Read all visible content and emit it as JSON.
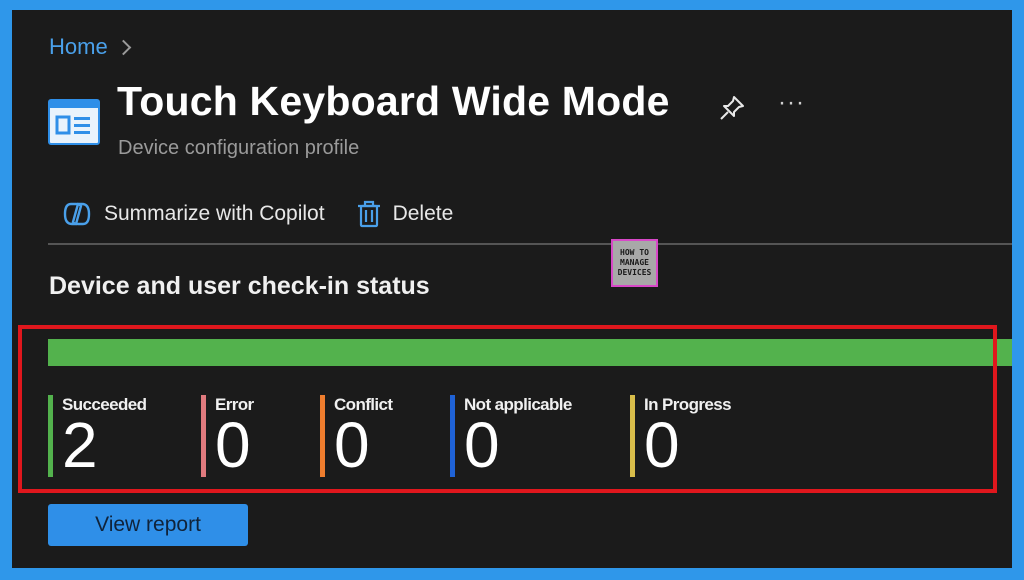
{
  "breadcrumb": {
    "home": "Home"
  },
  "page": {
    "title": "Touch Keyboard Wide Mode",
    "subtitle": "Device configuration profile",
    "more_label": "···"
  },
  "toolbar": {
    "summarize_label": "Summarize with Copilot",
    "delete_label": "Delete"
  },
  "watermark": {
    "top": "HOW TO",
    "line2": "MANAGE",
    "line3": "DEVICES"
  },
  "status": {
    "heading": "Device and user check-in status",
    "progress_fraction": 1.0,
    "progress_color": "#53b24d",
    "items": [
      {
        "label": "Succeeded",
        "value": "2",
        "color": "#53b24d"
      },
      {
        "label": "Error",
        "value": "0",
        "color": "#e07a7e"
      },
      {
        "label": "Conflict",
        "value": "0",
        "color": "#ef7d2e"
      },
      {
        "label": "Not applicable",
        "value": "0",
        "color": "#1f62d6"
      },
      {
        "label": "In Progress",
        "value": "0",
        "color": "#d8bd4a"
      }
    ]
  },
  "actions": {
    "view_report_label": "View report"
  },
  "colors": {
    "accent": "#2f97ea",
    "highlight": "#e0171d",
    "panel": "#1b1b1b"
  }
}
